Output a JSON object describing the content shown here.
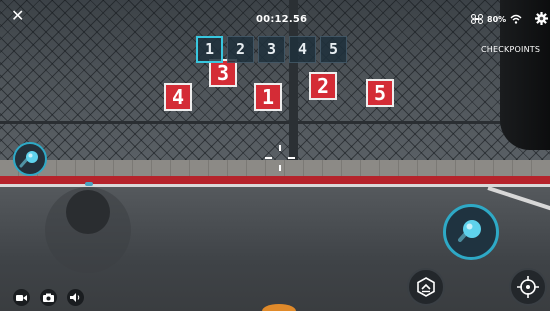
{
  "hud": {
    "close_icon": "close-icon",
    "timer": "00:12.56",
    "battery": "80%",
    "checkpoints_label": "CHECKPOINTS"
  },
  "checkpoints": [
    {
      "label": "1",
      "active": true
    },
    {
      "label": "2",
      "active": false
    },
    {
      "label": "3",
      "active": false
    },
    {
      "label": "4",
      "active": false
    },
    {
      "label": "5",
      "active": false
    }
  ],
  "targets": [
    "4",
    "3",
    "1",
    "2",
    "5"
  ],
  "colors": {
    "accent": "#2ea9c6",
    "target_red": "#d42c36",
    "floor_stripe": "#b5232b"
  },
  "icons": {
    "video": "video-camera-icon",
    "photo": "camera-icon",
    "sound": "speaker-icon",
    "wifi": "wifi-icon",
    "settings": "gear-icon",
    "shoot": "ball-icon",
    "takeoff": "drone-land-icon",
    "aim": "crosshair-target-icon"
  }
}
